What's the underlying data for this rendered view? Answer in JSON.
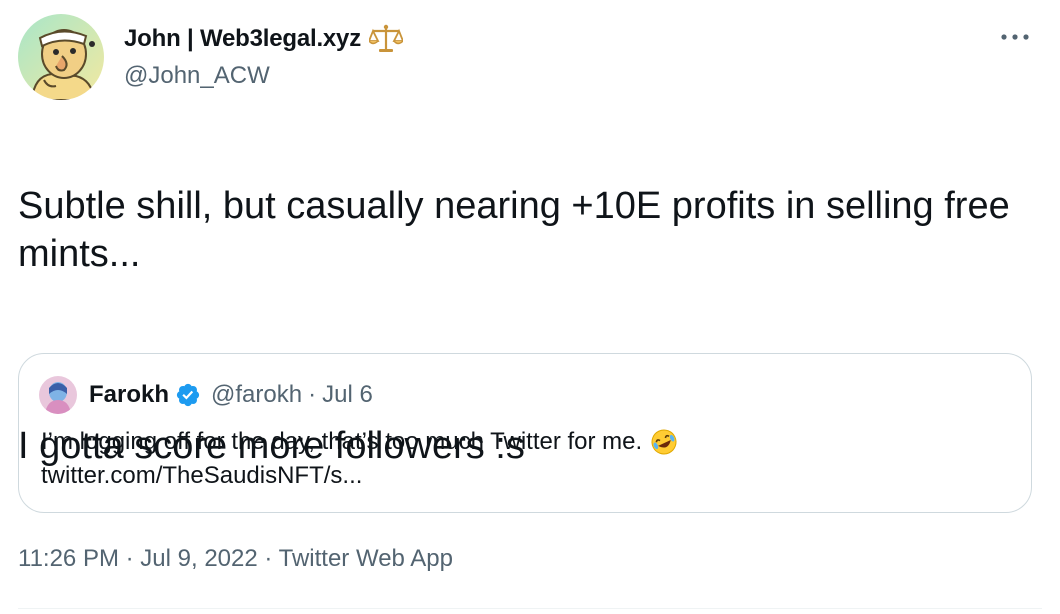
{
  "author": {
    "name": "John | Web3legal.xyz",
    "handle": "@John_ACW",
    "name_icon": "balance-scale-icon",
    "avatar": "cartoon-avatar"
  },
  "tweet": {
    "line1": "Subtle shill, but casually nearing +10E profits in selling free mints...",
    "line2": "I gotta score more followers :s"
  },
  "quote": {
    "name": "Farokh",
    "handle": "@farokh",
    "separator": "·",
    "date": "Jul 6",
    "text": "I’m logging off for the day, that’s too much Twitter for me.",
    "link": "twitter.com/TheSaudisNFT/s...",
    "verified_icon": "verified-badge-icon",
    "emoji": "rolling-on-floor-laughing"
  },
  "meta": {
    "time": "11:26 PM",
    "sep1": "·",
    "date": "Jul 9, 2022",
    "sep2": "·",
    "app": "Twitter Web App"
  },
  "colors": {
    "text": "#0f1419",
    "secondary": "#536471",
    "border": "#cfd9de",
    "verified": "#1d9bf0"
  }
}
